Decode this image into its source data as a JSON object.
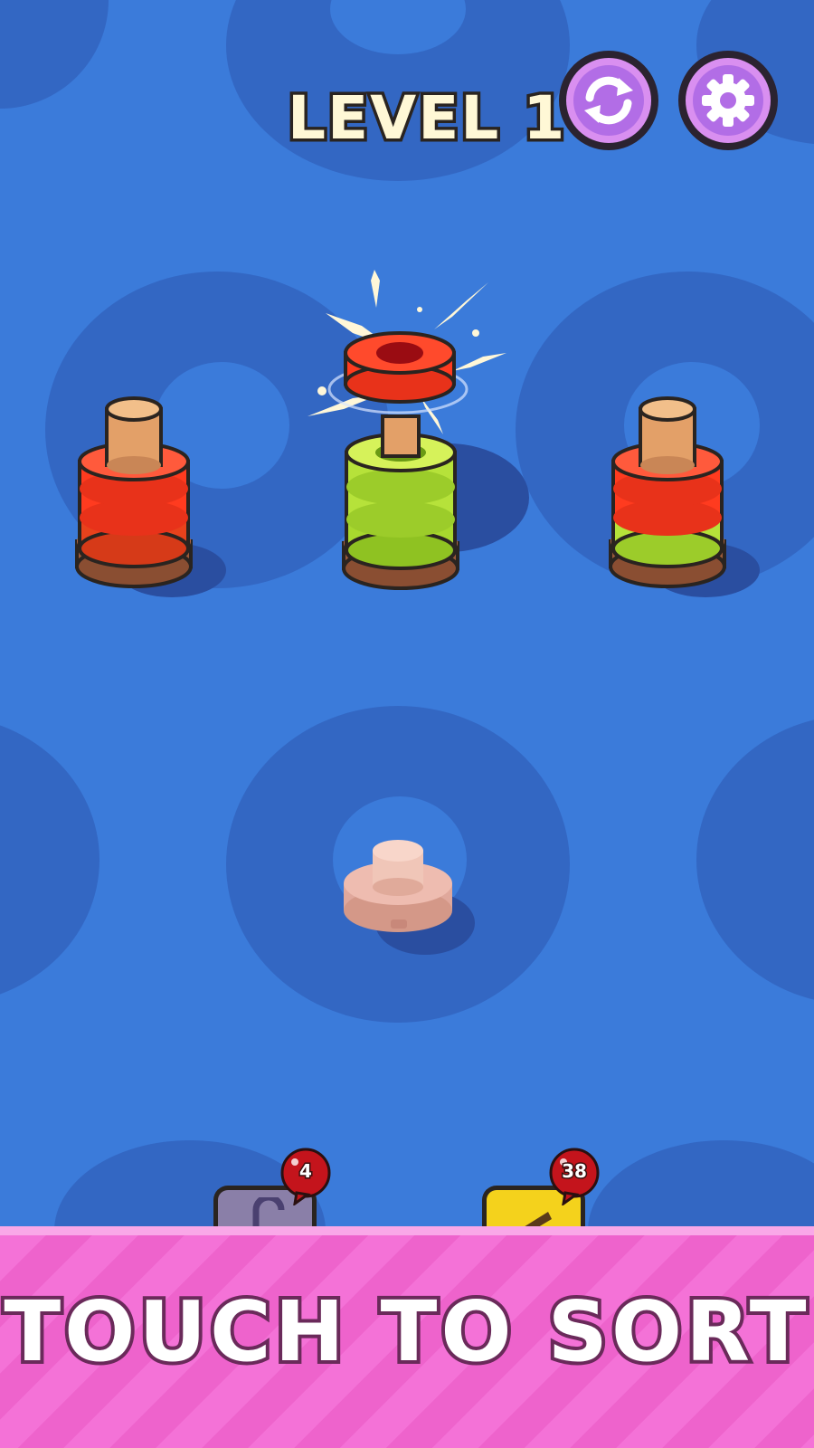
{
  "hud": {
    "level_label": "LEVEL 1",
    "restart_icon": "restart-icon",
    "settings_icon": "gear-icon"
  },
  "pegs": [
    {
      "rings": [
        "orange-red",
        "red",
        "red"
      ]
    },
    {
      "rings": [
        "green",
        "green",
        "green"
      ],
      "lifted_ring": "red"
    },
    {
      "rings": [
        "green",
        "red"
      ]
    },
    {
      "rings": []
    }
  ],
  "boosters": [
    {
      "name": "undo",
      "count": "4"
    },
    {
      "name": "hint",
      "count": "38"
    }
  ],
  "banner": {
    "text": "TOUCH TO SORT"
  },
  "colors": {
    "background": "#3b7bda",
    "ring_red": "#ff3b1f",
    "ring_green": "#b6e23a",
    "banner_pink": "#f472d7"
  }
}
